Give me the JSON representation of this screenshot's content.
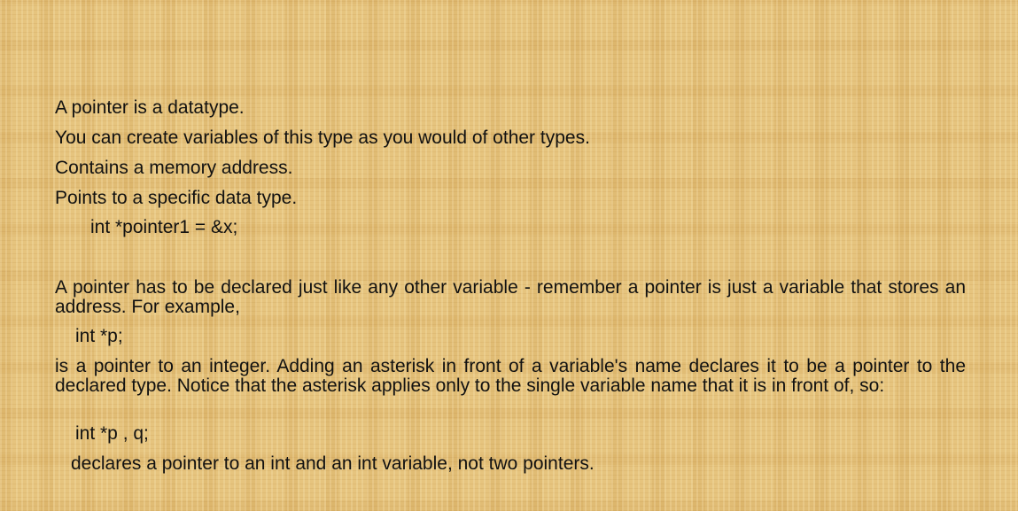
{
  "bullets": [
    "A pointer is a datatype.",
    "You can create variables of this type as you would of other types.",
    "Contains a memory address.",
    "Points to a specific data type."
  ],
  "code1": "int *pointer1 = &x;",
  "para1": "A pointer has to be declared just like any other variable - remember a pointer is just a variable that stores an address. For example,",
  "code2": "int *p;",
  "para2": "is a pointer to an integer. Adding an asterisk in front of a variable's name declares it to be a pointer to the declared type. Notice that the asterisk applies only to the single variable name that it is in front of, so:",
  "code3": "int *p , q;",
  "conclusion": "declares a pointer to an int and an int variable, not two pointers."
}
